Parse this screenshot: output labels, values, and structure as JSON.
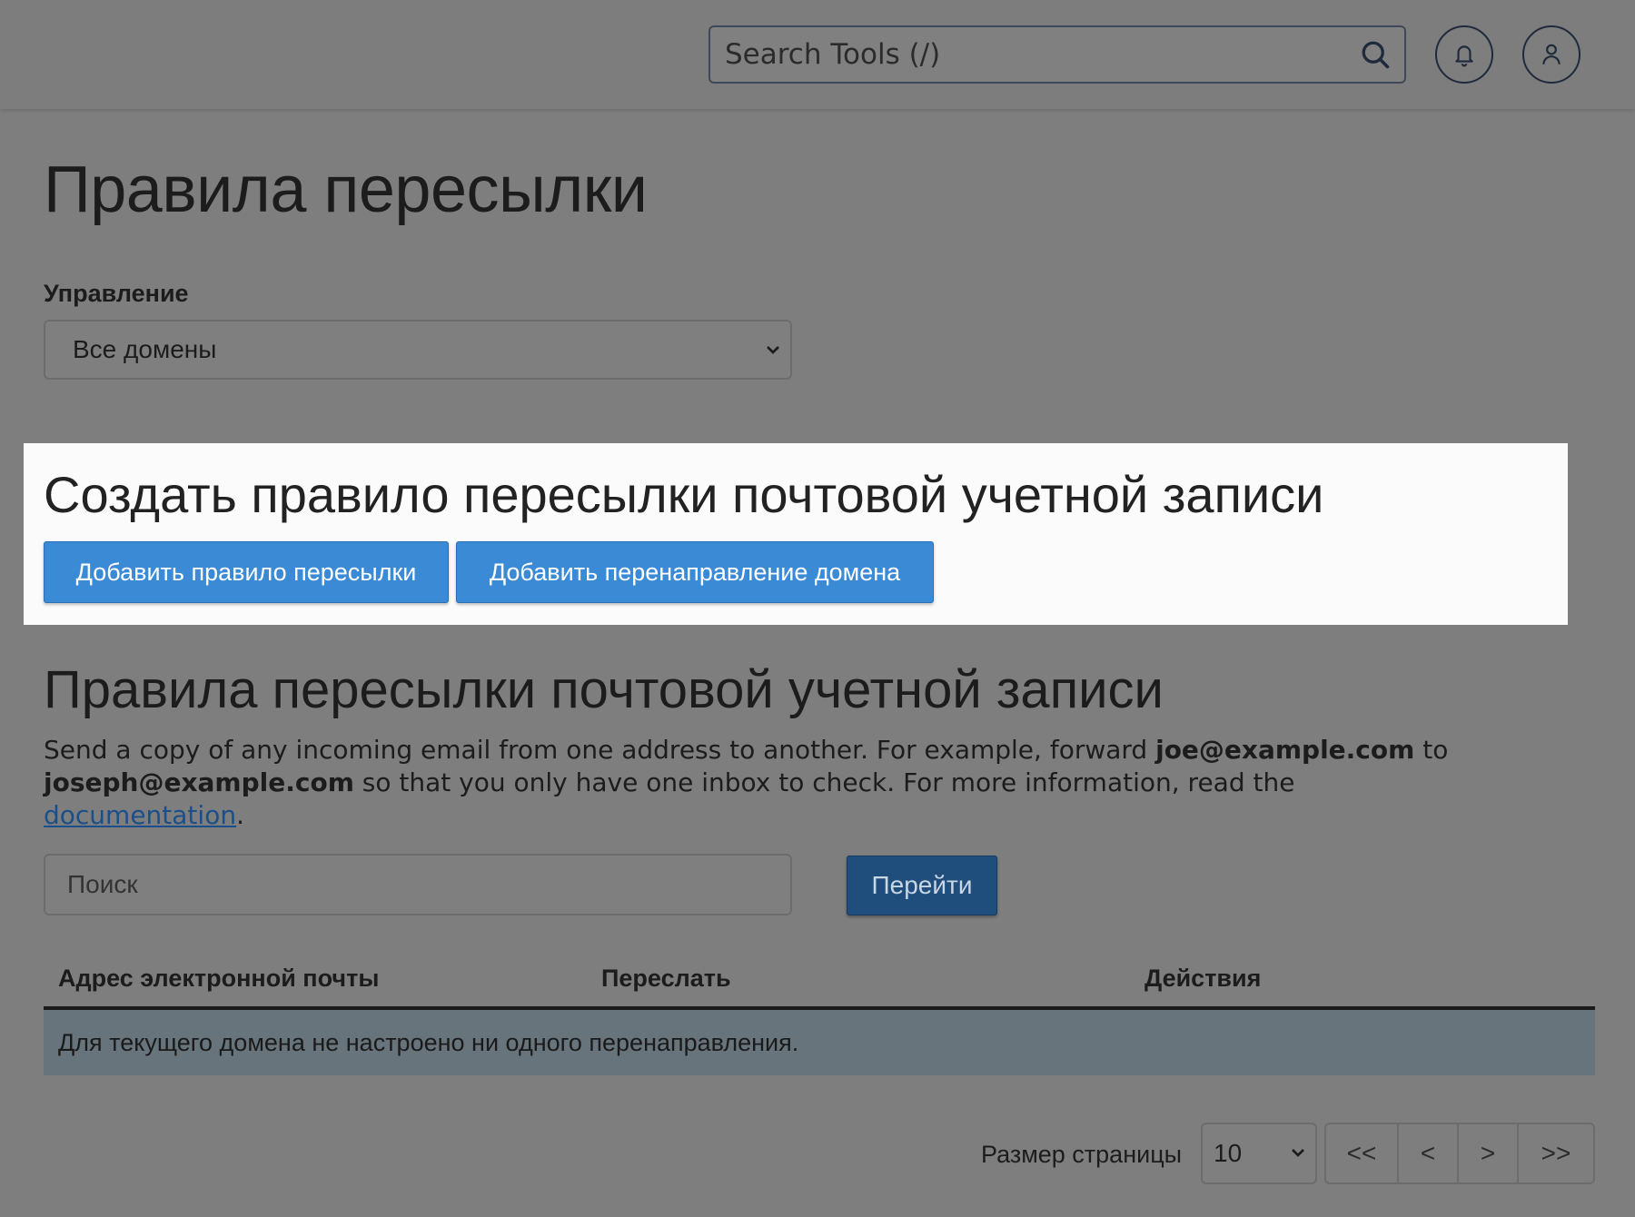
{
  "header": {
    "search_placeholder": "Search Tools (/)",
    "icons": {
      "search": "search-icon",
      "notifications": "bell-icon",
      "account": "user-icon"
    }
  },
  "page": {
    "title": "Правила пересылки"
  },
  "manage": {
    "label": "Управление",
    "selected_domain": "Все домены"
  },
  "create_section": {
    "title": "Создать правило пересылки почтовой учетной записи",
    "add_forwarder_label": "Добавить правило пересылки",
    "add_domain_forwarder_label": "Добавить перенаправление домена"
  },
  "forwarders_section": {
    "title": "Правила пересылки почтовой учетной записи",
    "description": {
      "part1": "Send a copy of any incoming email from one address to another. For example, forward ",
      "email1": "joe@example.com",
      "part2": " to ",
      "email2": "joseph@example.com",
      "part3": " so that you only have one inbox to check. For more information, read the ",
      "link": "documentation",
      "part4": "."
    },
    "search_placeholder": "Поиск",
    "go_label": "Перейти"
  },
  "table": {
    "columns": [
      "Адрес электронной почты",
      "Переслать",
      "Действия"
    ],
    "empty_message": "Для текущего домена не настроено ни одного перенаправления."
  },
  "pagination": {
    "page_size_label": "Размер страницы",
    "page_size": "10",
    "first": "<<",
    "prev": "<",
    "next": ">",
    "last": ">>"
  },
  "colors": {
    "primary_button": "#3a8ad6",
    "go_button": "#1f4d7c",
    "overlay_background": "#7e7e7e",
    "highlight_panel": "#fbfbfb"
  }
}
